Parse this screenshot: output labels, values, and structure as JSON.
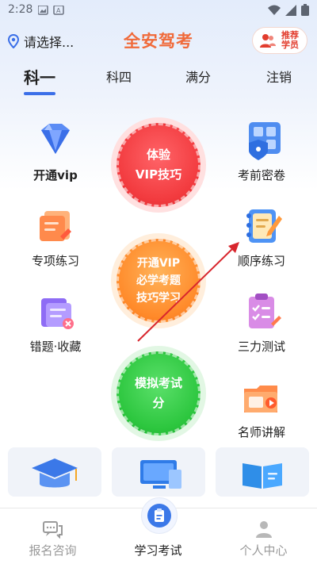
{
  "status_bar": {
    "time": "2:28"
  },
  "header": {
    "location": "请选择...",
    "title": "全安驾考",
    "recommend_label": "推荐学员"
  },
  "tabs": [
    {
      "label": "科一",
      "active": true
    },
    {
      "label": "科四",
      "active": false
    },
    {
      "label": "满分",
      "active": false
    },
    {
      "label": "注销",
      "active": false
    }
  ],
  "features_left": [
    {
      "label": "开通vip",
      "icon": "diamond-icon"
    },
    {
      "label": "专项练习",
      "icon": "practice-icon"
    },
    {
      "label": "错题·收藏",
      "icon": "wrong-questions-icon"
    }
  ],
  "features_right": [
    {
      "label": "考前密卷",
      "icon": "secret-paper-icon"
    },
    {
      "label": "顺序练习",
      "icon": "sequential-practice-icon"
    },
    {
      "label": "三力测试",
      "icon": "three-abilities-icon"
    },
    {
      "label": "名师讲解",
      "icon": "teacher-video-icon"
    }
  ],
  "circle_buttons": {
    "vip_trial": {
      "line1": "体验",
      "line2": "VIP技巧"
    },
    "open_vip": {
      "line1": "开通VIP",
      "line2": "必学考题",
      "line3": "技巧学习"
    },
    "mock_exam": {
      "line1": "模拟考试",
      "line2": "分"
    }
  },
  "bottom_cards": [
    {
      "icon": "graduation-cap-icon"
    },
    {
      "icon": "computer-icon"
    },
    {
      "icon": "book-icon"
    }
  ],
  "tabbar": [
    {
      "label": "报名咨询",
      "icon": "chat-icon",
      "active": false
    },
    {
      "label": "学习考试",
      "icon": "clipboard-icon",
      "active": true
    },
    {
      "label": "个人中心",
      "icon": "user-icon",
      "active": false
    }
  ],
  "colors": {
    "accent": "#3b6fe8",
    "title": "#f06a3a",
    "red_circle": "#f43b3f",
    "orange_circle": "#ff8a2a",
    "green_circle": "#2cc63e"
  }
}
